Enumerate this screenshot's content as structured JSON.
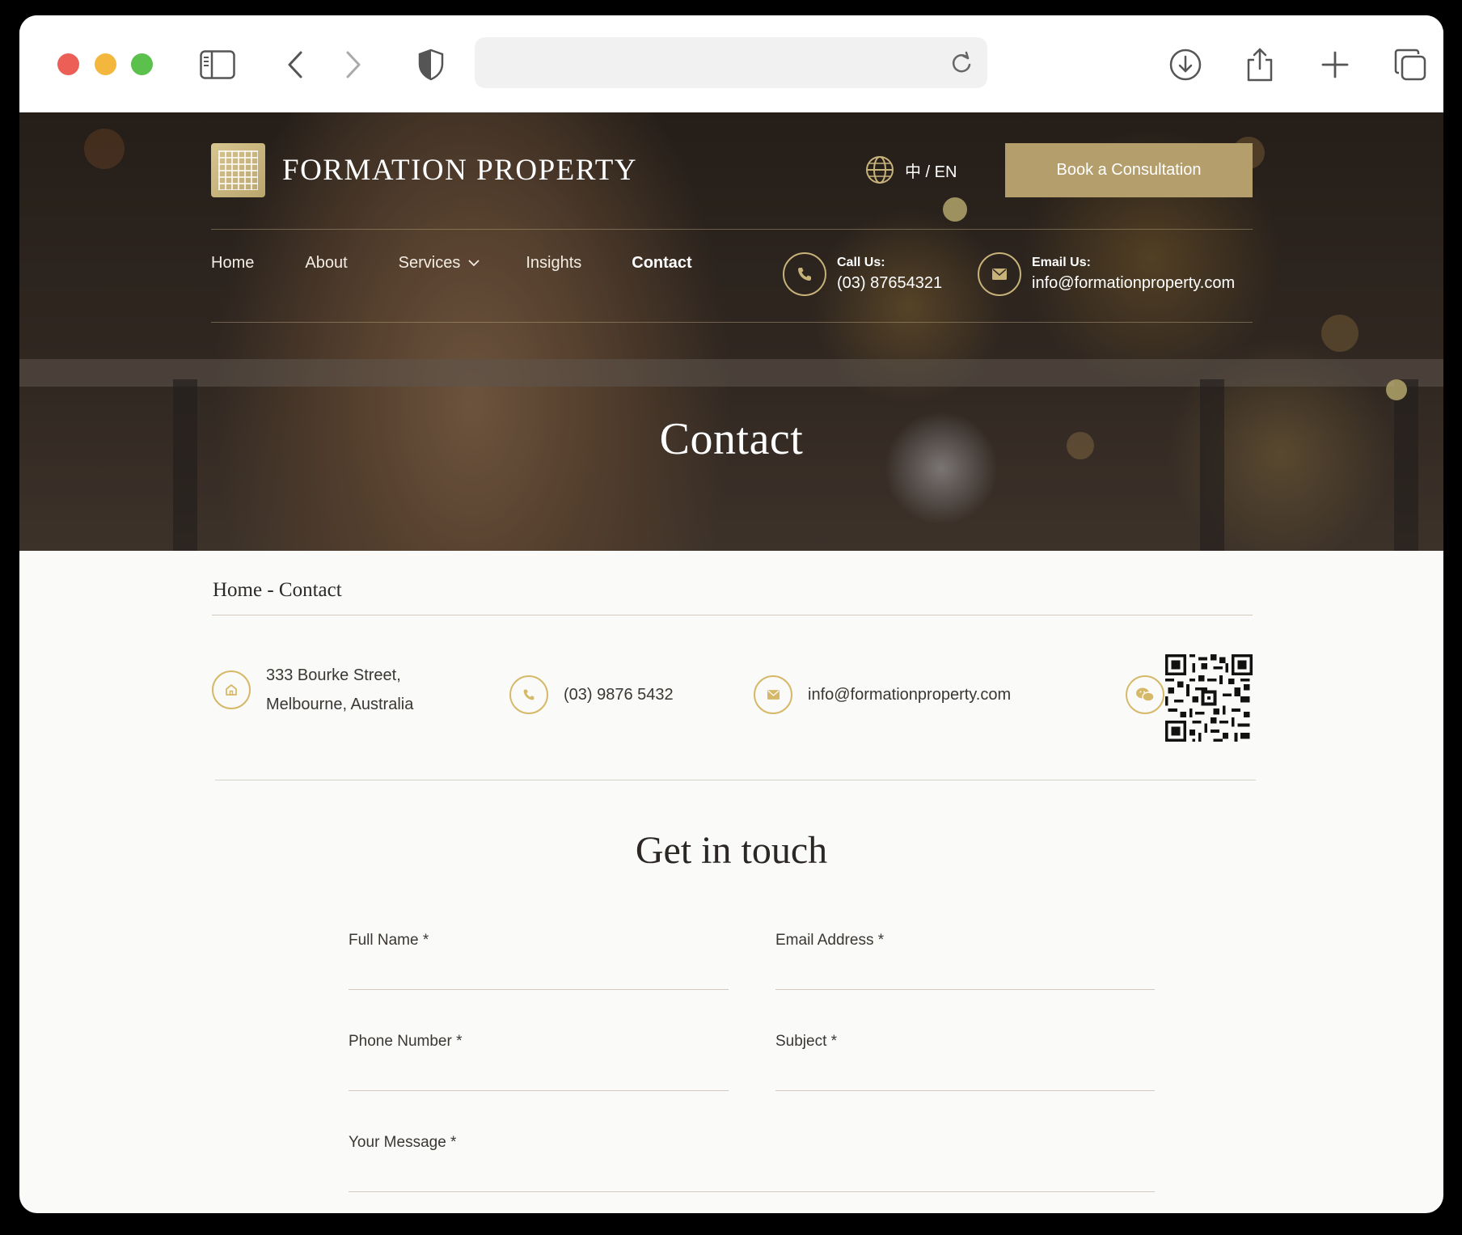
{
  "browser": {
    "url": "",
    "icons": [
      "sidebar-icon",
      "back-icon",
      "forward-icon",
      "shield-icon",
      "reload-icon",
      "download-icon",
      "share-icon",
      "new-tab-icon",
      "tabs-icon"
    ]
  },
  "header": {
    "brand": "FORMATION PROPERTY",
    "language": "中 / EN",
    "cta": "Book a Consultation",
    "nav": [
      {
        "label": "Home"
      },
      {
        "label": "About"
      },
      {
        "label": "Services"
      },
      {
        "label": "Insights"
      },
      {
        "label": "Contact"
      }
    ],
    "call": {
      "label": "Call Us:",
      "value": "(03) 87654321"
    },
    "email": {
      "label": "Email Us:",
      "value": "info@formationproperty.com"
    }
  },
  "hero": {
    "title": "Contact"
  },
  "breadcrumb": "Home - Contact",
  "info": {
    "address_line1": "333 Bourke Street,",
    "address_line2": "Melbourne, Australia",
    "phone": "(03) 9876 5432",
    "email": "info@formationproperty.com"
  },
  "form": {
    "title": "Get in touch",
    "full_name_label": "Full Name *",
    "email_label": "Email Address *",
    "phone_label": "Phone Number *",
    "subject_label": "Subject *",
    "message_label": "Your Message *",
    "full_name_value": "",
    "email_value": "",
    "phone_value": "",
    "subject_value": "",
    "message_value": ""
  },
  "colors": {
    "gold": "#b49e6b",
    "gold_line": "#d6b968",
    "text": "#3a3733",
    "page_bg": "#fafaf9"
  }
}
